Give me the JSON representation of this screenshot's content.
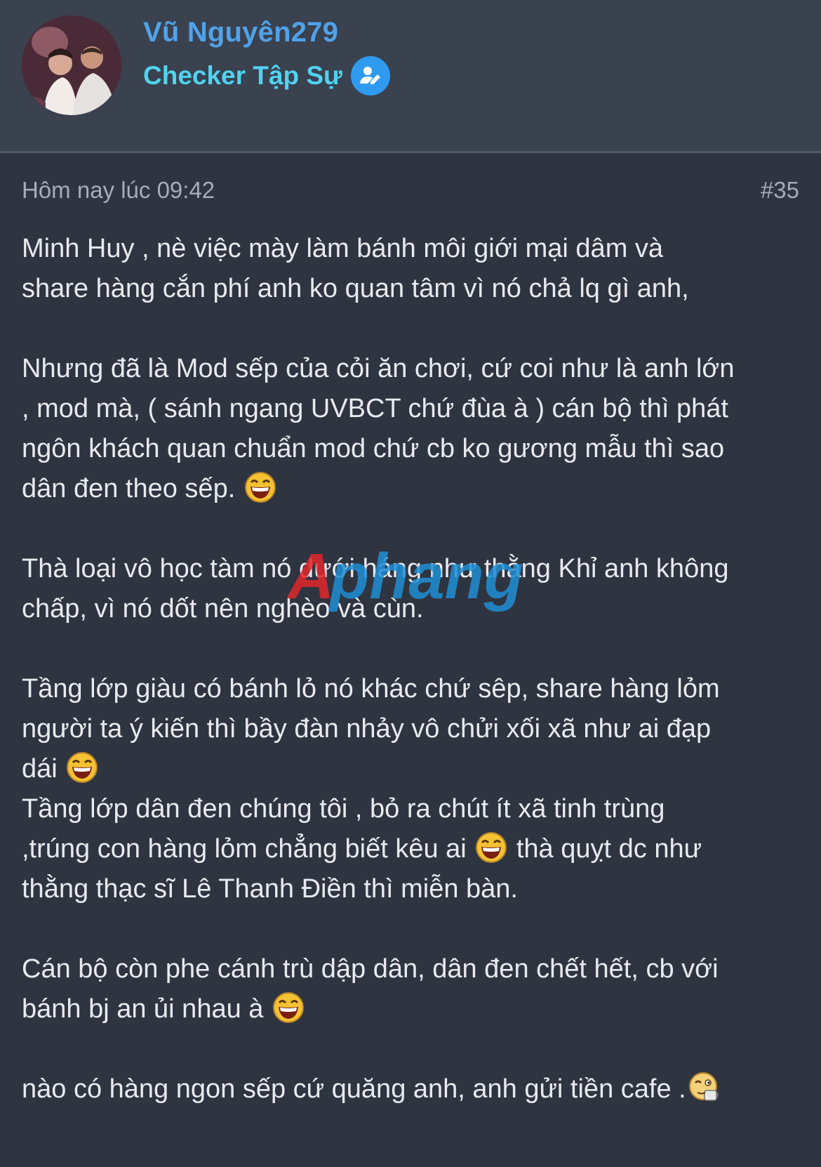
{
  "author": {
    "name": "Vũ Nguyên279",
    "rank": "Checker Tập Sự",
    "rank_icon": "user-edit-icon"
  },
  "post": {
    "time": "Hôm nay lúc 09:42",
    "number": "#35",
    "lines": [
      {
        "text": "Minh Huy , nè việc mày làm bánh môi giới mại dâm và",
        "emoji": null,
        "after": ""
      },
      {
        "text": "share hàng cắn phí anh ko quan tâm vì nó chả lq gì anh,",
        "emoji": null,
        "after": ""
      },
      {
        "text": "",
        "emoji": null,
        "after": ""
      },
      {
        "text": "Nhưng đã là Mod sếp của cỏi ăn chơi, cứ coi như là anh lớn",
        "emoji": null,
        "after": ""
      },
      {
        "text": ", mod mà, ( sánh ngang UVBCT chứ đùa à ) cán bộ thì phát",
        "emoji": null,
        "after": ""
      },
      {
        "text": "ngôn khách quan chuẩn mod chứ cb ko gương mẫu thì sao",
        "emoji": null,
        "after": ""
      },
      {
        "text": "dân đen theo sếp. ",
        "emoji": "laughing",
        "after": ""
      },
      {
        "text": "",
        "emoji": null,
        "after": ""
      },
      {
        "text": "Thà loại vô học tàm nó dưới háng như thằng Khỉ anh không",
        "emoji": null,
        "after": ""
      },
      {
        "text": "chấp, vì nó dốt nên nghèo và cùn.",
        "emoji": null,
        "after": ""
      },
      {
        "text": "",
        "emoji": null,
        "after": ""
      },
      {
        "text": "Tầng lớp giàu có bánh lỏ nó khác chứ sêp, share hàng lỏm",
        "emoji": null,
        "after": ""
      },
      {
        "text": "người ta ý kiến thì bầy đàn nhảy vô chửi xối xã như ai đạp",
        "emoji": null,
        "after": ""
      },
      {
        "text": "dái ",
        "emoji": "laughing",
        "after": ""
      },
      {
        "text": "Tầng lớp dân đen chúng tôi , bỏ ra chút ít xã tinh trùng",
        "emoji": null,
        "after": ""
      },
      {
        "text": ",trúng con hàng lỏm chẳng biết kêu ai ",
        "emoji": "laughing",
        "after": " thà quỵt dc như"
      },
      {
        "text": "thằng thạc sĩ Lê Thanh Điền thì miễn bàn.",
        "emoji": null,
        "after": ""
      },
      {
        "text": "",
        "emoji": null,
        "after": ""
      },
      {
        "text": "Cán bộ còn phe cánh trù dập dân, dân đen chết hết, cb với",
        "emoji": null,
        "after": ""
      },
      {
        "text": "bánh bj an ủi nhau à ",
        "emoji": "laughing",
        "after": ""
      },
      {
        "text": "",
        "emoji": null,
        "after": ""
      },
      {
        "text": "nào có hàng ngon sếp cứ quăng anh, anh gửi tiền cafe .",
        "emoji": "coffee-sip",
        "after": ""
      }
    ]
  },
  "watermark": {
    "text": "Aphang",
    "colors": [
      "#e0262a",
      "#1f8fd6"
    ]
  },
  "colors": {
    "background": "#2e3440",
    "header": "#3a414f",
    "username": "#4fa3ea",
    "rank": "#4fd3f0",
    "text": "#e8eaee",
    "meta": "#a7adb8"
  }
}
